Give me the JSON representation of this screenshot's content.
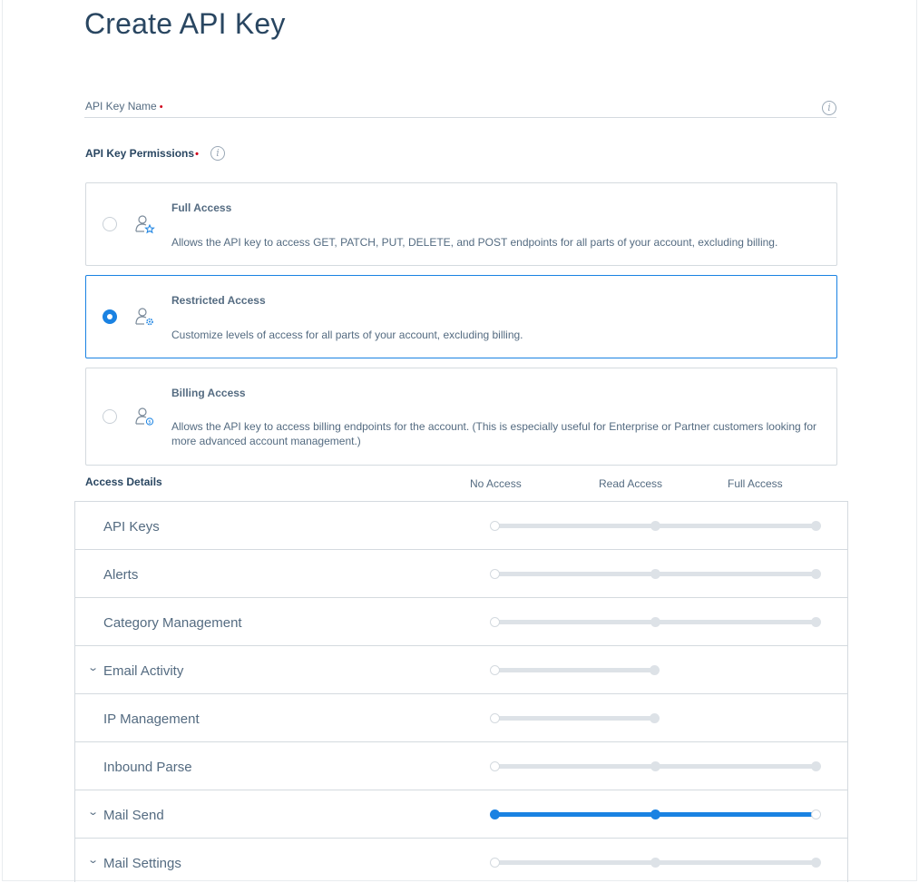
{
  "page": {
    "title": "Create API Key"
  },
  "name_field": {
    "label": "API Key Name",
    "required_mark": "•"
  },
  "permissions": {
    "label": "API Key Permissions",
    "required_mark": "•",
    "options": [
      {
        "title": "Full Access",
        "description": "Allows the API key to access GET, PATCH, PUT, DELETE, and POST endpoints for all parts of your account, excluding billing.",
        "selected": false,
        "icon": "user-star-icon"
      },
      {
        "title": "Restricted Access",
        "description": "Customize levels of access for all parts of your account, excluding billing.",
        "selected": true,
        "icon": "user-gear-icon"
      },
      {
        "title": "Billing Access",
        "description": "Allows the API key to access billing endpoints for the account. (This is especially useful for Enterprise or Partner customers looking for more advanced account management.)",
        "selected": false,
        "icon": "user-dollar-icon"
      }
    ]
  },
  "access_details": {
    "label": "Access Details",
    "columns": [
      "No Access",
      "Read Access",
      "Full Access"
    ],
    "rows": [
      {
        "label": "API Keys",
        "expandable": false,
        "levels": 3,
        "value": "No Access"
      },
      {
        "label": "Alerts",
        "expandable": false,
        "levels": 3,
        "value": "No Access"
      },
      {
        "label": "Category Management",
        "expandable": false,
        "levels": 3,
        "value": "No Access"
      },
      {
        "label": "Email Activity",
        "expandable": true,
        "levels": 2,
        "value": "No Access"
      },
      {
        "label": "IP Management",
        "expandable": false,
        "levels": 2,
        "value": "No Access"
      },
      {
        "label": "Inbound Parse",
        "expandable": false,
        "levels": 3,
        "value": "No Access"
      },
      {
        "label": "Mail Send",
        "expandable": true,
        "levels": 3,
        "value": "Full Access"
      },
      {
        "label": "Mail Settings",
        "expandable": true,
        "levels": 3,
        "value": "No Access"
      }
    ]
  },
  "colors": {
    "accent": "#1a82e2",
    "text": "#294661",
    "muted": "#546b81",
    "border": "#d4dadf",
    "track": "#dde2e7",
    "required": "#d0021b"
  }
}
